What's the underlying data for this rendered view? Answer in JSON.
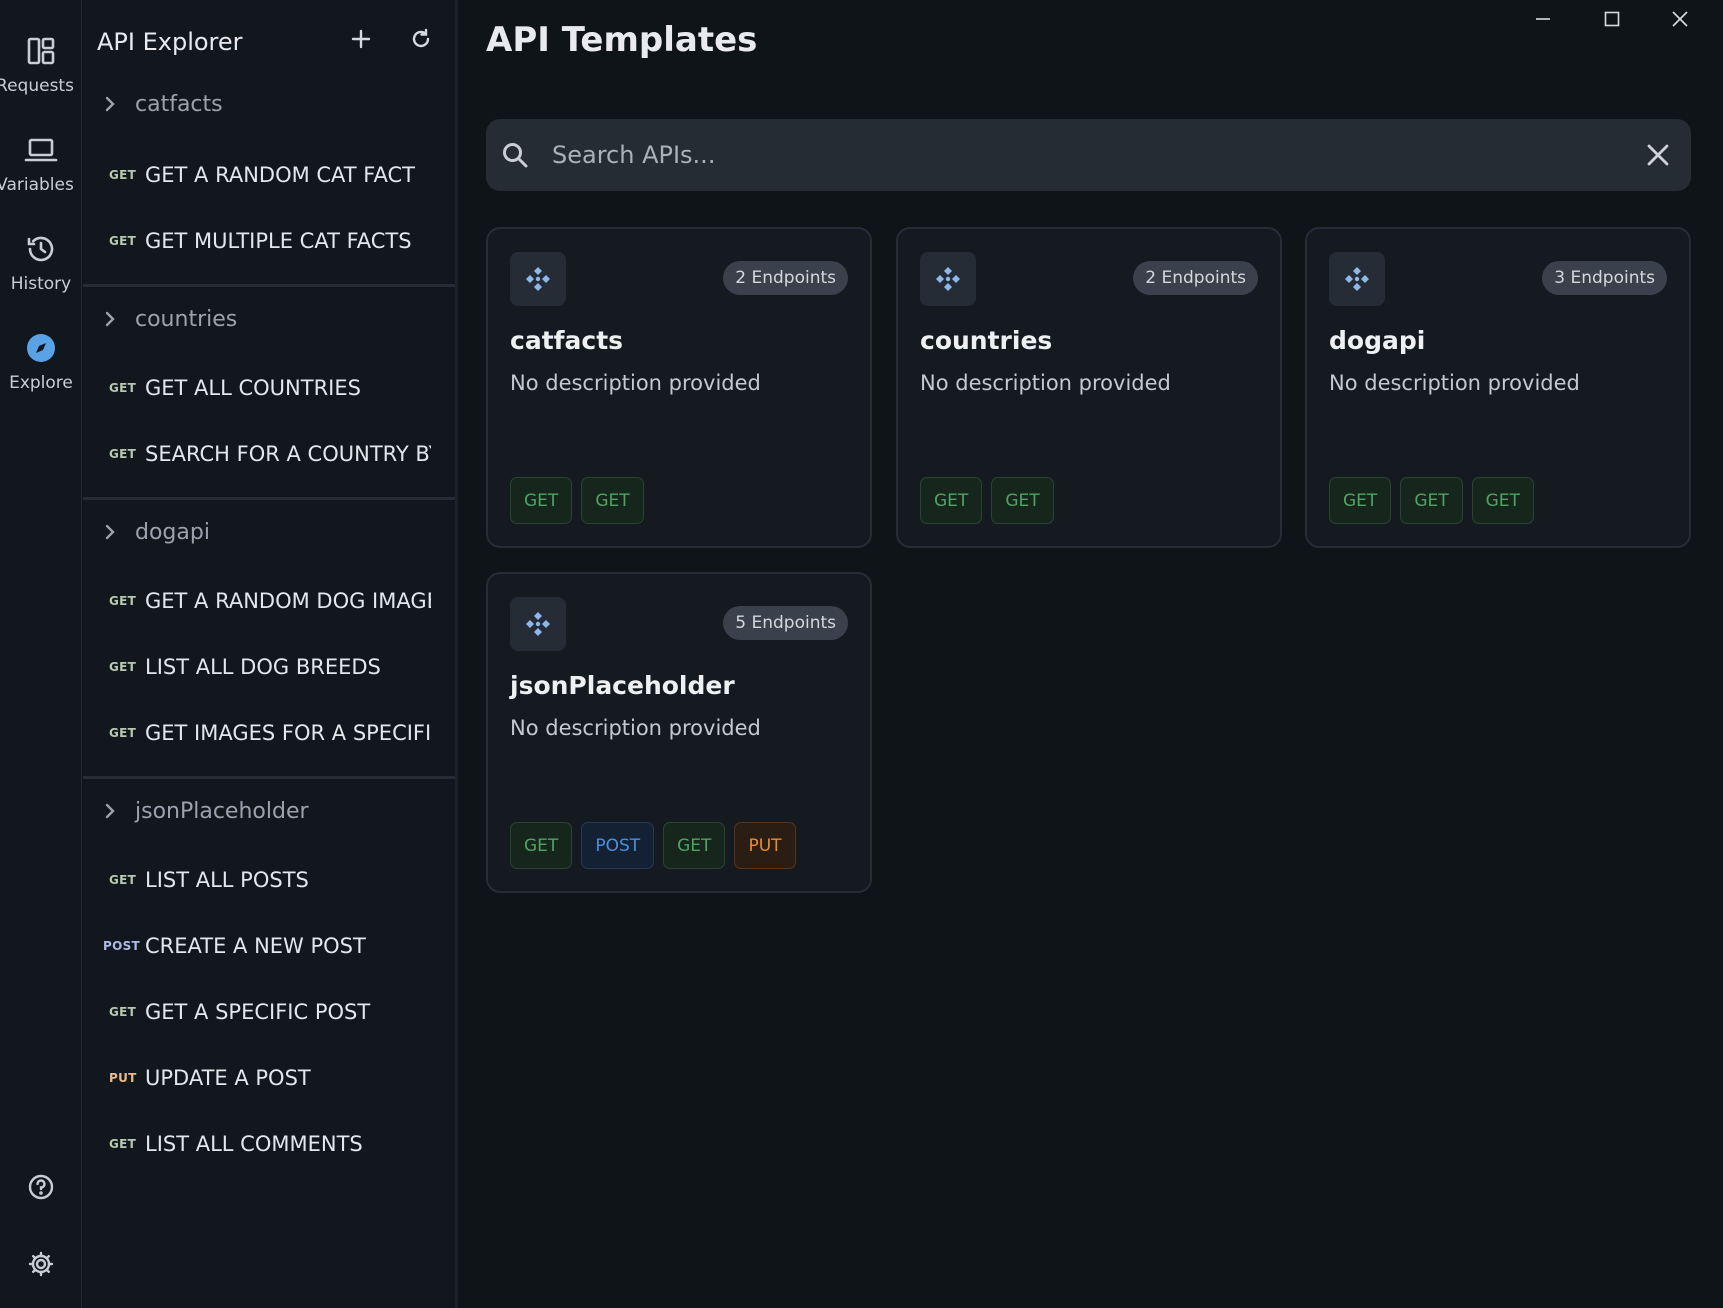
{
  "rail": {
    "items": [
      {
        "label": "Requests",
        "icon": "layout-icon"
      },
      {
        "label": "Variables",
        "icon": "laptop-icon"
      },
      {
        "label": "History",
        "icon": "history-icon"
      },
      {
        "label": "Explore",
        "icon": "compass-icon"
      }
    ],
    "active": "Explore",
    "accent": "#5aa2e6"
  },
  "explorer": {
    "title": "API Explorer",
    "groups": [
      {
        "name": "catfacts",
        "endpoints": [
          {
            "method": "GET",
            "name": "GET A RANDOM CAT FACT"
          },
          {
            "method": "GET",
            "name": "GET MULTIPLE CAT FACTS"
          }
        ]
      },
      {
        "name": "countries",
        "endpoints": [
          {
            "method": "GET",
            "name": "GET ALL COUNTRIES"
          },
          {
            "method": "GET",
            "name": "SEARCH FOR A COUNTRY BY"
          }
        ]
      },
      {
        "name": "dogapi",
        "endpoints": [
          {
            "method": "GET",
            "name": "GET A RANDOM DOG IMAGE"
          },
          {
            "method": "GET",
            "name": "LIST ALL DOG BREEDS"
          },
          {
            "method": "GET",
            "name": "GET IMAGES FOR A SPECIFIC"
          }
        ]
      },
      {
        "name": "jsonPlaceholder",
        "endpoints": [
          {
            "method": "GET",
            "name": "LIST ALL POSTS"
          },
          {
            "method": "POST",
            "name": "CREATE A NEW POST"
          },
          {
            "method": "GET",
            "name": "GET A SPECIFIC POST"
          },
          {
            "method": "PUT",
            "name": "UPDATE A POST"
          },
          {
            "method": "GET",
            "name": "LIST ALL COMMENTS"
          }
        ]
      }
    ]
  },
  "main": {
    "title": "API Templates",
    "search_placeholder": "Search APIs...",
    "cards": [
      {
        "name": "catfacts",
        "count": "2 Endpoints",
        "description": "No description provided",
        "methods": [
          "GET",
          "GET"
        ]
      },
      {
        "name": "countries",
        "count": "2 Endpoints",
        "description": "No description provided",
        "methods": [
          "GET",
          "GET"
        ]
      },
      {
        "name": "dogapi",
        "count": "3 Endpoints",
        "description": "No description provided",
        "methods": [
          "GET",
          "GET",
          "GET"
        ]
      },
      {
        "name": "jsonPlaceholder",
        "count": "5 Endpoints",
        "description": "No description provided",
        "methods": [
          "GET",
          "POST",
          "GET",
          "PUT"
        ]
      }
    ]
  },
  "colors": {
    "get": "#4fa462",
    "post": "#4b8fe0",
    "put": "#f08a2c"
  }
}
